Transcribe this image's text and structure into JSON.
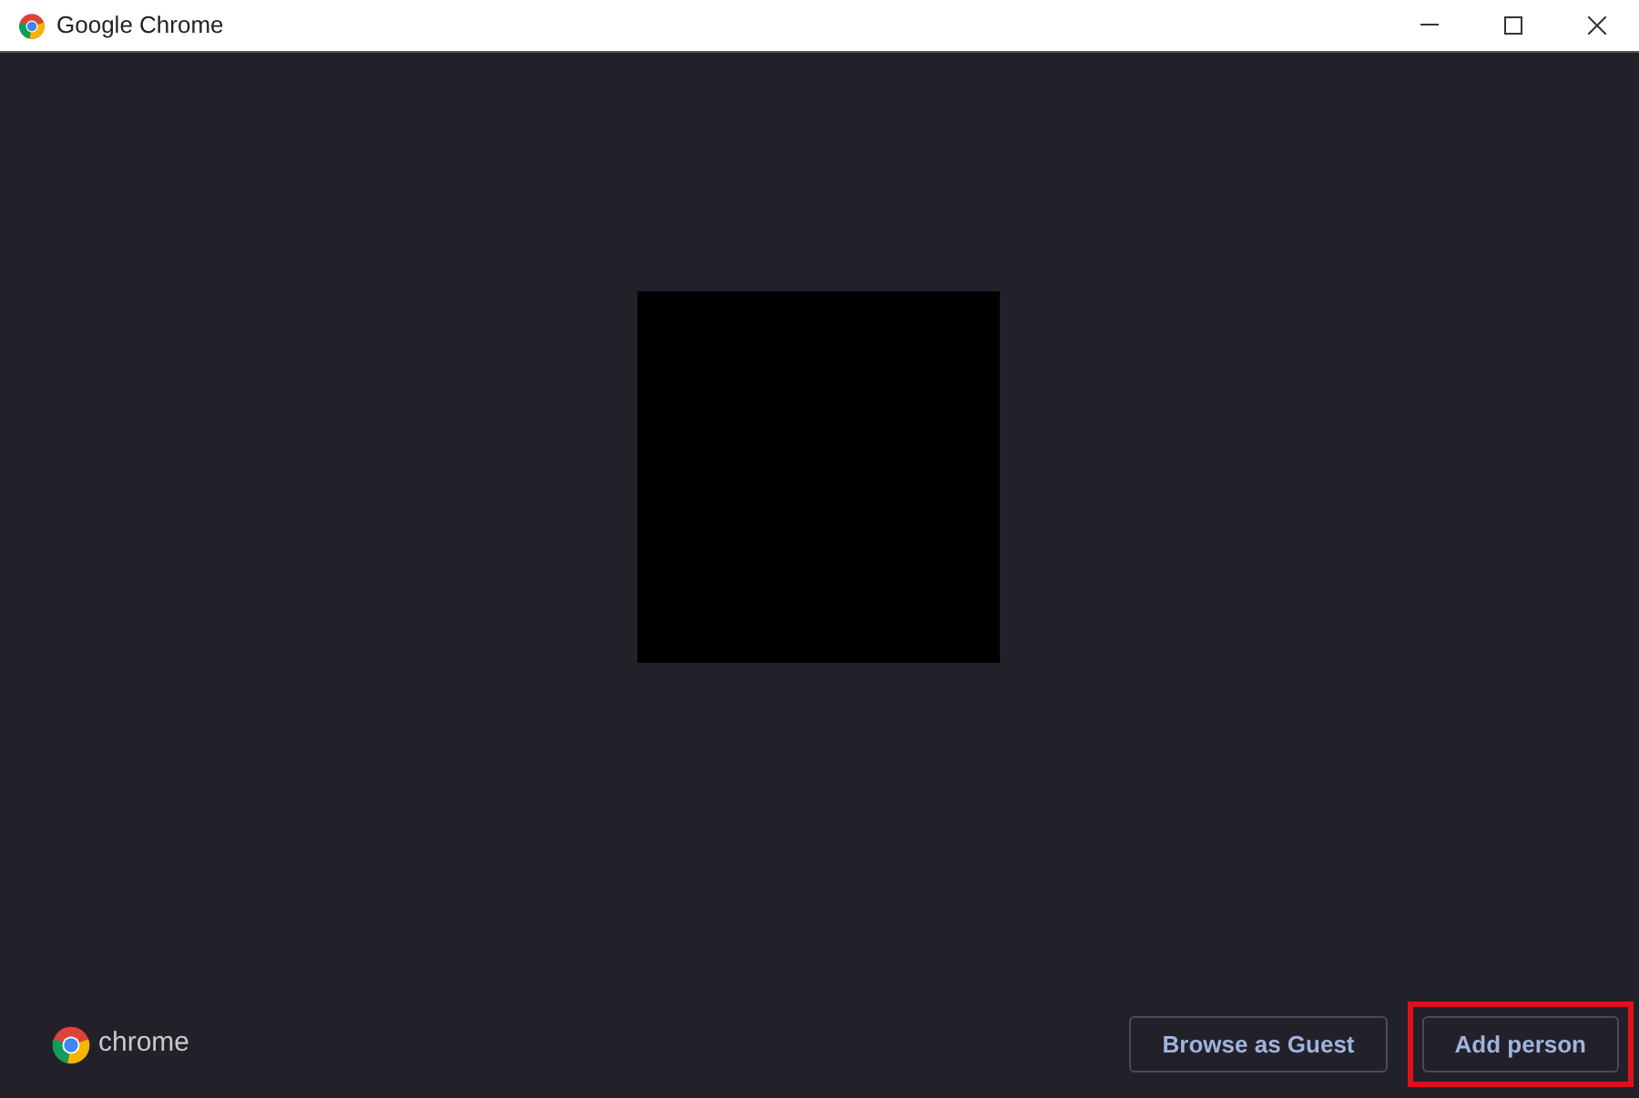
{
  "window": {
    "title": "Google Chrome"
  },
  "brand": {
    "wordmark": "chrome"
  },
  "buttons": [
    {
      "label": "Browse as Guest",
      "highlighted": false
    },
    {
      "label": "Add person",
      "highlighted": true
    }
  ]
}
